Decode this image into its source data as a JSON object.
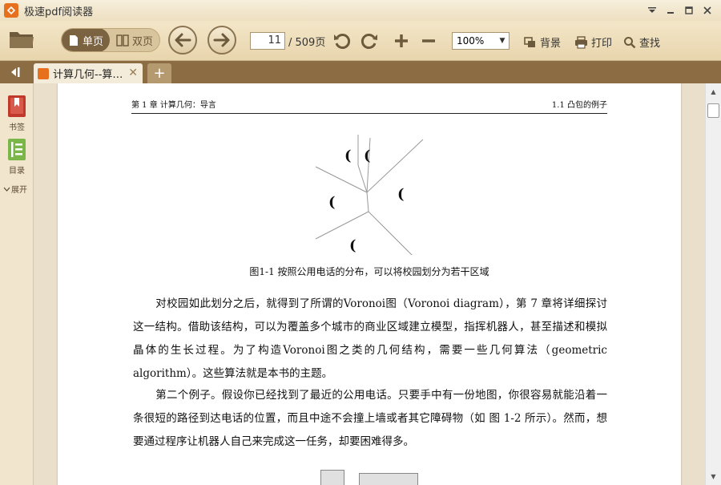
{
  "window": {
    "title": "极速pdf阅读器",
    "logo_icon": "pdf-reader-logo"
  },
  "toolbar": {
    "single_page_label": "单页",
    "double_page_label": "双页",
    "current_page": "11",
    "total_pages_label": "/ 509页",
    "zoom": "100%",
    "background_label": "背景",
    "print_label": "打印",
    "find_label": "查找"
  },
  "tabs": [
    {
      "label": "计算几何--算…"
    }
  ],
  "sidebar": {
    "bookmark_label": "书签",
    "toc_label": "目录",
    "expand_label": "展开"
  },
  "document": {
    "running_head_left": "第 1 章  计算几何：导言",
    "running_head_right": "1.1  凸包的例子",
    "figure_caption": "图1-1  按照公用电话的分布，可以将校园划分为若干区域",
    "paragraph1": "对校园如此划分之后，就得到了所谓的Voronoi图（Voronoi diagram），第 7 章将详细探讨这一结构。借助该结构，可以为覆盖多个城市的商业区域建立模型，指挥机器人，甚至描述和模拟晶体的生长过程。为了构造Voronoi图之类的几何结构，需要一些几何算法（geometric algorithm）。这些算法就是本书的主题。",
    "paragraph2": "第二个例子。假设你已经找到了最近的公用电话。只要手中有一份地图，你很容易就能沿着一条很短的路径到达电话的位置，而且中途不会撞上墙或者其它障碍物（如 图 1-2 所示）。然而，想要通过程序让机器人自己来完成这一任务，却要困难得多。"
  },
  "colors": {
    "toolbar_bg": "#eddcb8",
    "tab_strip": "#8c6c42",
    "accent_orange": "#e6701e",
    "bookmark_red": "#c0392b",
    "toc_green": "#7ab648"
  }
}
